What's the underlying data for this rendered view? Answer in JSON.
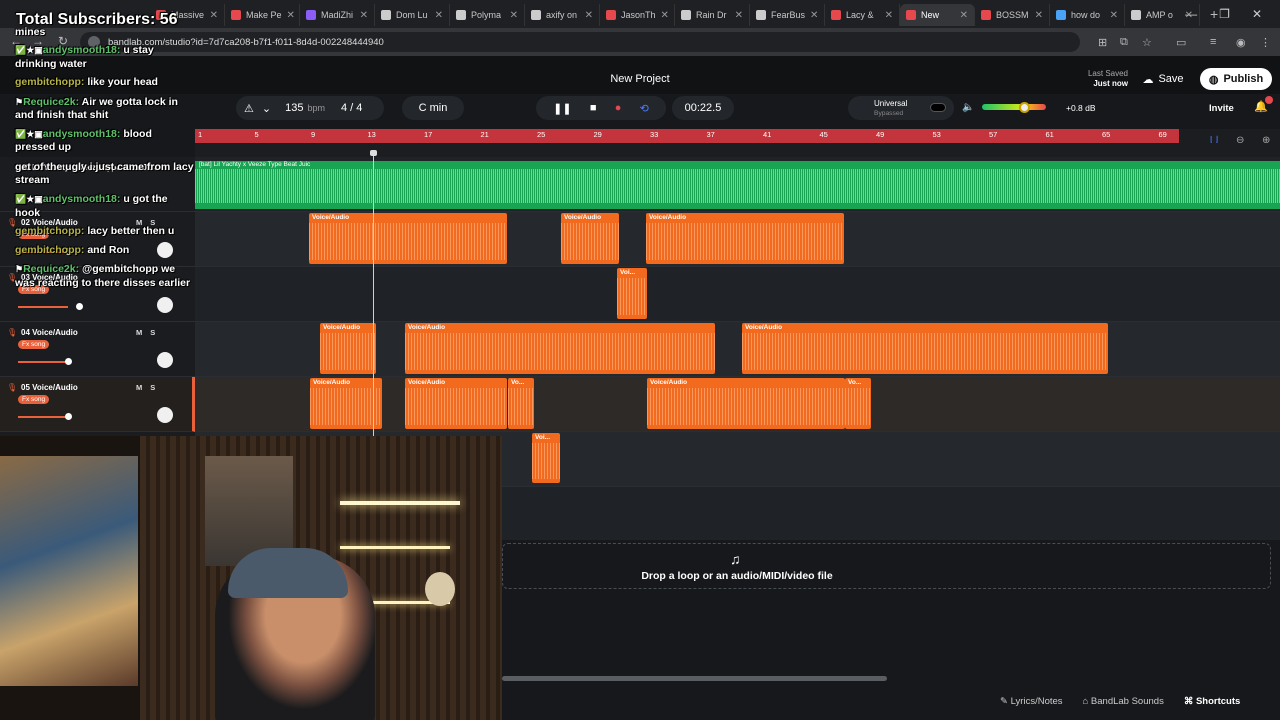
{
  "browser": {
    "tabs": [
      {
        "label": "Massive",
        "color": "#e5484d"
      },
      {
        "label": "Make Pe",
        "color": "#e5484d"
      },
      {
        "label": "MadiZhi",
        "color": "#8b5cf6"
      },
      {
        "label": "Dom Lu",
        "color": "#cccccc"
      },
      {
        "label": "Polyma",
        "color": "#cccccc"
      },
      {
        "label": "axify on",
        "color": "#cccccc"
      },
      {
        "label": "JasonTh",
        "color": "#e5484d"
      },
      {
        "label": "Rain Dr",
        "color": "#cccccc"
      },
      {
        "label": "FearBus",
        "color": "#cccccc"
      },
      {
        "label": "Lacy &",
        "color": "#e5484d"
      },
      {
        "label": "New",
        "color": "#e5484d"
      },
      {
        "label": "BOSSM",
        "color": "#e5484d"
      },
      {
        "label": "how do",
        "color": "#4aa3f5"
      },
      {
        "label": "AMP o",
        "color": "#cccccc"
      }
    ],
    "url": "bandlab.com/studio?id=7d7ca208-b7f1-f011-8d4d-002248444940"
  },
  "header": {
    "project_title": "New Project",
    "last_saved_label": "Last Saved",
    "last_saved_value": "Just now",
    "save_label": "Save",
    "publish_label": "Publish"
  },
  "transport": {
    "bpm_value": "135",
    "bpm_unit": "bpm",
    "time_signature": "4 / 4",
    "key": "C min",
    "time": "00:22.5",
    "preset_name": "Universal",
    "preset_state": "Bypassed",
    "master_db": "+0.8 dB",
    "invite_label": "Invite"
  },
  "ruler": {
    "ticks": [
      "1",
      "5",
      "9",
      "13",
      "17",
      "21",
      "25",
      "29",
      "33",
      "37",
      "41",
      "45",
      "49",
      "53",
      "57",
      "61",
      "65",
      "69"
    ]
  },
  "tracks": [
    {
      "name": "01 Lil Yachty x Veeze Type Beat Juic",
      "fx": ""
    },
    {
      "name": "02 Voice/Audio",
      "fx": "Fx song"
    },
    {
      "name": "03 Voice/Audio",
      "fx": "Fx song"
    },
    {
      "name": "04  Voice/Audio",
      "fx": "Fx song"
    },
    {
      "name": "05  Voice/Audio",
      "fx": "Fx song"
    }
  ],
  "beat_clip_label": "[bat] Lil Yachty x Veeze Type Beat Juic",
  "clip_label": "Voice/Audio",
  "clip_label_short": "Vo...",
  "clip_label_short2": "Voi...",
  "dropzone": {
    "text": "Drop a loop or an audio/MIDI/video file"
  },
  "footer": {
    "lyrics": "Lyrics/Notes",
    "sounds": "BandLab Sounds",
    "shortcuts": "Shortcuts"
  },
  "overlay": {
    "subscribers": "Total Subscribers: 56",
    "chat": [
      {
        "user": "",
        "msg": "mines"
      },
      {
        "user": "andysmooth18:",
        "msg": "u stay"
      },
      {
        "user": "",
        "msg": "drinking water"
      },
      {
        "user": "gembitchopp:",
        "msg": "like your head"
      },
      {
        "user": "Requice2k:",
        "msg": "Air we gotta lock in"
      },
      {
        "user": "",
        "msg": "and finish that shit"
      },
      {
        "user": "andysmooth18:",
        "msg": "blood"
      },
      {
        "user": "",
        "msg": "pressed up"
      },
      {
        "user": "",
        "msg": "get of the ugly i just came from lacy"
      },
      {
        "user": "",
        "msg": "stream"
      },
      {
        "user": "andysmooth18:",
        "msg": "u got the"
      },
      {
        "user": "",
        "msg": "hook"
      },
      {
        "user": "gembitchopp:",
        "msg": "lacy better then u"
      },
      {
        "user": "gembitchopp:",
        "msg": "and Ron"
      },
      {
        "user": "Requice2k:",
        "msg": "@gembitchopp we"
      },
      {
        "user": "",
        "msg": "was reacting to there disses earlier"
      }
    ]
  }
}
